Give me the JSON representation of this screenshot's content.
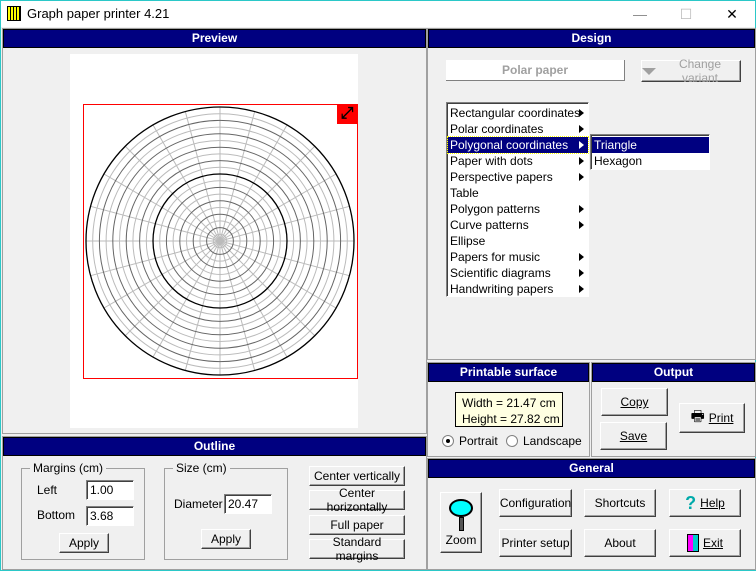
{
  "window": {
    "title": "Graph paper printer 4.21",
    "minimize": "—",
    "maximize": "☐",
    "close": "✕"
  },
  "preview": {
    "header": "Preview",
    "paper_type": "polar",
    "rings": 20,
    "spokes": 24
  },
  "design": {
    "header": "Design",
    "current_paper": "Polar paper",
    "change_variant": "Change variant",
    "categories": [
      {
        "label": "Rectangular coordinates",
        "submenu": true
      },
      {
        "label": "Polar coordinates",
        "submenu": true
      },
      {
        "label": "Polygonal coordinates",
        "submenu": true,
        "selected": true
      },
      {
        "label": "Paper with dots",
        "submenu": true
      },
      {
        "label": "Perspective papers",
        "submenu": true
      },
      {
        "label": "Table",
        "submenu": false
      },
      {
        "label": "Polygon patterns",
        "submenu": true
      },
      {
        "label": "Curve patterns",
        "submenu": true
      },
      {
        "label": "Ellipse",
        "submenu": false
      },
      {
        "label": "Papers for music",
        "submenu": true
      },
      {
        "label": "Scientific diagrams",
        "submenu": true
      },
      {
        "label": "Handwriting papers",
        "submenu": true
      }
    ],
    "submenu": [
      {
        "label": "Triangle",
        "selected": true
      },
      {
        "label": "Hexagon"
      }
    ]
  },
  "outline": {
    "header": "Outline",
    "margins_label": "Margins (cm)",
    "left_label": "Left",
    "left_value": "1.00",
    "bottom_label": "Bottom",
    "bottom_value": "3.68",
    "apply": "Apply",
    "size_label": "Size (cm)",
    "diameter_label": "Diameter",
    "diameter_value": "20.47",
    "center_v": "Center vertically",
    "center_h": "Center horizontally",
    "full_paper": "Full paper",
    "standard_margins": "Standard margins"
  },
  "printable": {
    "header": "Printable surface",
    "width": "Width = 21.47 cm",
    "height": "Height = 27.82 cm",
    "portrait": "Portrait",
    "landscape": "Landscape",
    "orientation": "Portrait"
  },
  "output": {
    "header": "Output",
    "copy": "Copy",
    "save": "Save",
    "print": "Print"
  },
  "general": {
    "header": "General",
    "zoom": "Zoom",
    "configuration": "Configuration",
    "shortcuts": "Shortcuts",
    "help": "Help",
    "printer_setup": "Printer setup",
    "about": "About",
    "exit": "Exit"
  }
}
